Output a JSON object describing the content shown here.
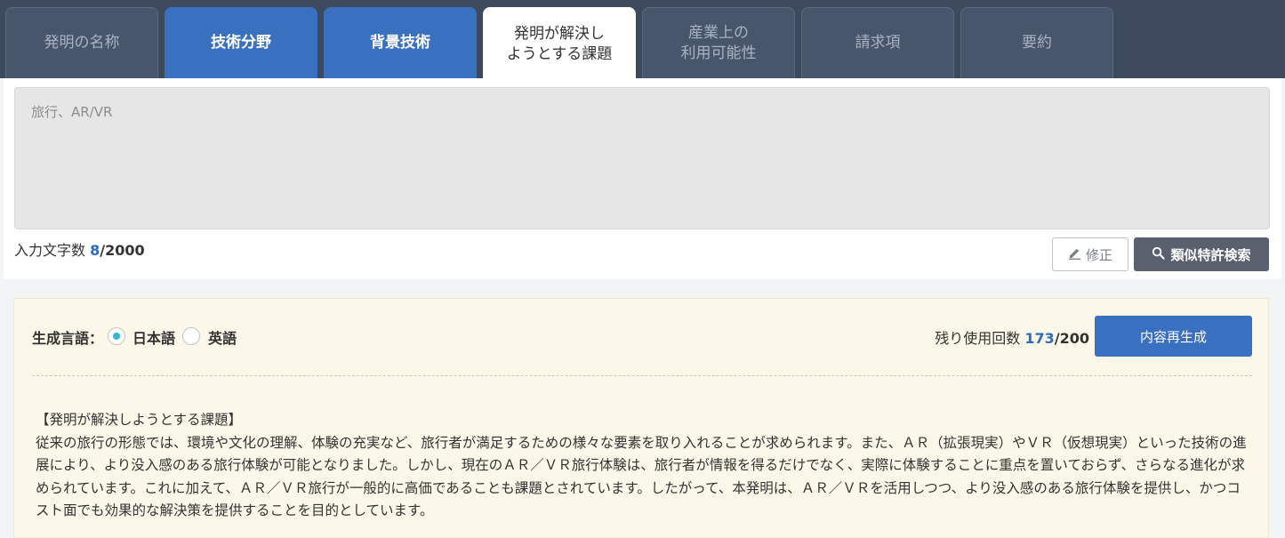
{
  "tabs": [
    {
      "label": "発明の名称",
      "state": "inactive"
    },
    {
      "label": "技術分野",
      "state": "highlight"
    },
    {
      "label": "背景技術",
      "state": "highlight"
    },
    {
      "label": "発明が解決し\nようとする課題",
      "state": "active"
    },
    {
      "label": "産業上の\n利用可能性",
      "state": "inactive"
    },
    {
      "label": "請求項",
      "state": "inactive"
    },
    {
      "label": "要約",
      "state": "inactive"
    }
  ],
  "input": {
    "value": "旅行、AR/VR",
    "counter_label": "入力文字数",
    "count": "8",
    "max": "/2000"
  },
  "buttons": {
    "edit_label": "修正",
    "search_label": "類似特許検索",
    "regenerate_label": "内容再生成"
  },
  "generation": {
    "language_label": "生成言語：",
    "options": [
      "日本語",
      "英語"
    ],
    "selected": "日本語",
    "usage_label": "残り使用回数",
    "usage_count": "173",
    "usage_max": "/200"
  },
  "result": {
    "heading": "【発明が解決しようとする課題】",
    "body": "従来の旅行の形態では、環境や文化の理解、体験の充実など、旅行者が満足するための様々な要素を取り入れることが求められます。また、ＡＲ（拡張現実）やＶＲ（仮想現実）といった技術の進展により、より没入感のある旅行体験が可能となりました。しかし、現在のＡＲ／ＶＲ旅行体験は、旅行者が情報を得るだけでなく、実際に体験することに重点を置いておらず、さらなる進化が求められています。これに加えて、ＡＲ／ＶＲ旅行が一般的に高価であることも課題とされています。したがって、本発明は、ＡＲ／ＶＲを活用しつつ、より没入感のある旅行体験を提供し、かつコスト面でも効果的な解決策を提供することを目的としています。"
  },
  "colors": {
    "tabbar": "#3d4a5e",
    "accent": "#3a70c0",
    "radio_selected": "#33b7c9",
    "result_bg": "#fbf8e9"
  }
}
